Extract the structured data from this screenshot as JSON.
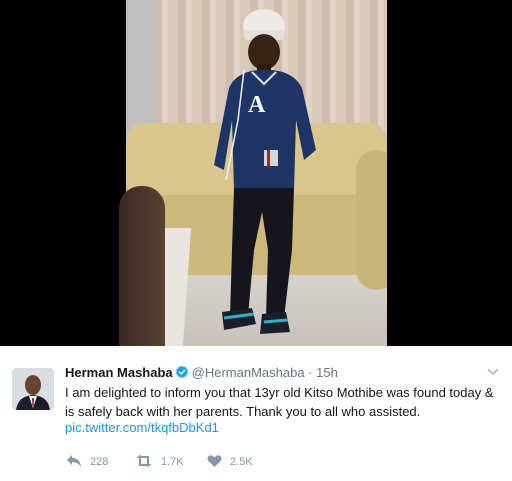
{
  "tweet": {
    "author": "Herman Mashaba",
    "handle": "@HermanMashaba",
    "separator": "·",
    "time": "15h",
    "text": "I am delighted to inform you that 13yr old Kitso Mothibe was found today & is safely back with her parents. Thank you to all who assisted.",
    "link": "pic.twitter.com/tkqfbDbKd1",
    "replies": "228",
    "retweets": "1.7K",
    "likes": "2.5K"
  },
  "icons": {
    "verified": "verified-badge-icon",
    "more": "chevron-down-icon",
    "reply": "reply-icon",
    "retweet": "retweet-icon",
    "like": "heart-icon"
  },
  "colors": {
    "verified": "#1da1f2",
    "link": "#1b95e0",
    "muted": "#657786",
    "action": "#8899a6"
  }
}
